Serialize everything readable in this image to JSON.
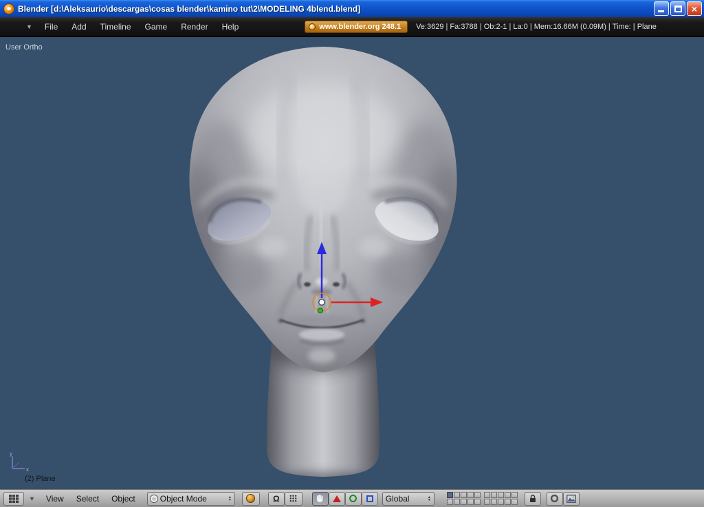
{
  "colors": {
    "viewport-bg": "#36506b",
    "accent-orange": "#d08a2a",
    "xp-blue": "#0f52c8",
    "header-dark": "#141414",
    "panel-gray": "#b2b2b2"
  },
  "titlebar": {
    "title": "Blender [d:\\Aleksaurio\\descargas\\cosas blender\\kamino tut\\2\\MODELING 4blend.blend]"
  },
  "menubar": {
    "items": [
      "File",
      "Add",
      "Timeline",
      "Game",
      "Render",
      "Help"
    ],
    "badge_label": "www.blender.org 248.1",
    "stats": "Ve:3629 | Fa:3788 | Ob:2-1 | La:0 | Mem:16.66M (0.09M)  | Time: | Plane"
  },
  "viewport": {
    "view_label": "User Ortho",
    "object_label": "(2) Plane"
  },
  "bottombar": {
    "menus": [
      "View",
      "Select",
      "Object"
    ],
    "mode_value": "Object Mode",
    "orientation_value": "Global",
    "layers": {
      "active": 1
    }
  },
  "icons": {
    "close_glyph": "×",
    "collapse_arrow": "▼",
    "pivot_glyph": "Ω",
    "dd_up": "▲",
    "dd_down": "▼"
  }
}
